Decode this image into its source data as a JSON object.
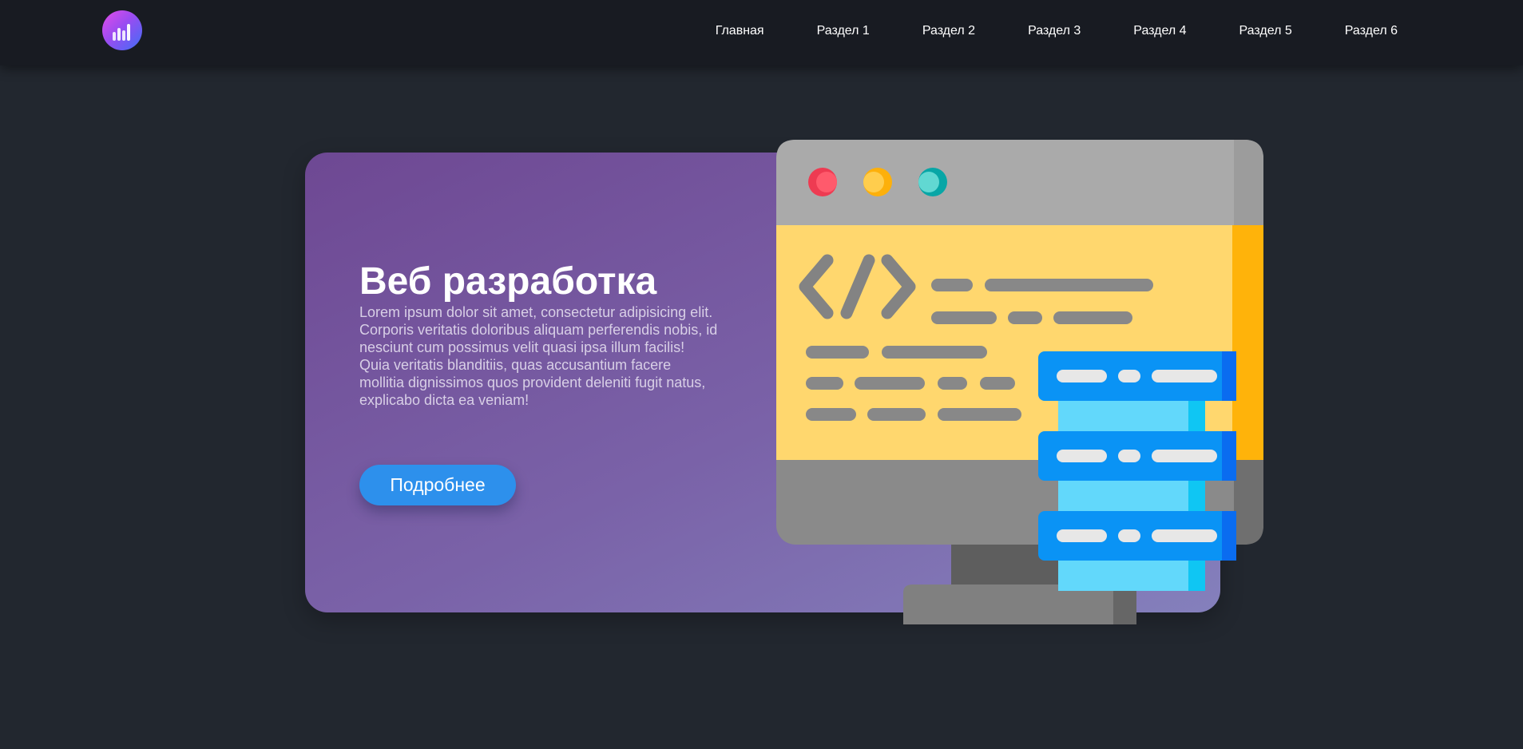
{
  "header": {
    "logo": {
      "icon": "bar-chart-logo-icon"
    },
    "nav": [
      {
        "label": "Главная"
      },
      {
        "label": "Раздел 1"
      },
      {
        "label": "Раздел 2"
      },
      {
        "label": "Раздел 3"
      },
      {
        "label": "Раздел 4"
      },
      {
        "label": "Раздел 5"
      },
      {
        "label": "Раздел 6"
      }
    ]
  },
  "hero": {
    "title": "Веб разработка",
    "text": "Lorem ipsum dolor sit amet, consectetur adipisicing elit. Corporis veritatis doloribus aliquam perferendis nobis, id nesciunt cum possimus velit quasi ipsa illum facilis! Quia veritatis blanditiis, quas accusantium facere mollitia dignissimos quos provident deleniti fugit natus, explicabo dicta ea veniam!",
    "button_label": "Подробнее",
    "illustration_icon": "web-development-monitor-icon"
  },
  "colors": {
    "background": "#22272f",
    "header": "#181b22",
    "card_gradient_start": "#6e4893",
    "card_gradient_end": "#8480bc",
    "button": "#2d90ec",
    "window_yellow": "#ffd76e",
    "server_blue": "#0a93f5"
  }
}
